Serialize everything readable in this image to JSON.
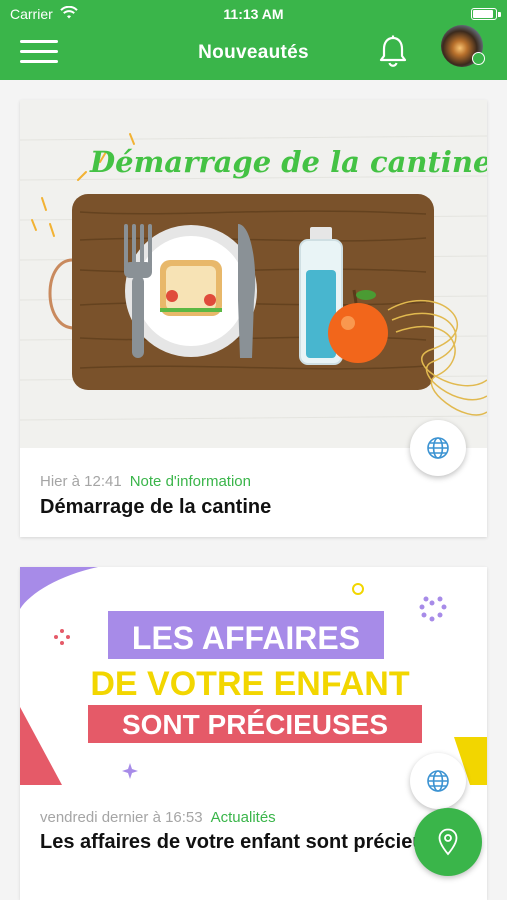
{
  "status_bar": {
    "carrier": "Carrier",
    "time": "11:13 AM"
  },
  "header": {
    "title": "Nouveautés"
  },
  "cards": [
    {
      "image_text": "Démarrage de la cantine",
      "date": "Hier à 12:41",
      "category": "Note d'information",
      "title": "Démarrage de la cantine"
    },
    {
      "image_lines": [
        "LES AFFAIRES",
        "DE VOTRE ENFANT",
        "SONT PRÉCIEUSES"
      ],
      "date": "vendredi dernier à 16:53",
      "category": "Actualités",
      "title": "Les affaires de votre enfant sont précieuses"
    }
  ],
  "colors": {
    "brand": "#3ab54a",
    "purple": "#a78be8",
    "yellow": "#f2d600",
    "red": "#e55a68"
  },
  "icons": [
    "menu-icon",
    "bell-icon",
    "globe-icon",
    "map-pin-icon",
    "wifi-icon",
    "battery-icon"
  ]
}
